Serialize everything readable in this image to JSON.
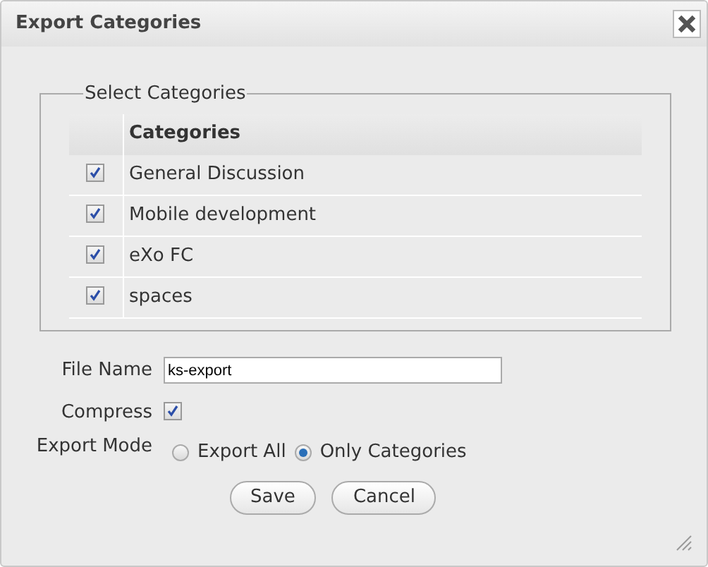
{
  "window": {
    "title": "Export Categories"
  },
  "fieldset": {
    "legend": "Select Categories",
    "column": "Categories",
    "rows": [
      {
        "name": "General Discussion",
        "checked": true
      },
      {
        "name": "Mobile development",
        "checked": true
      },
      {
        "name": "eXo FC",
        "checked": true
      },
      {
        "name": "spaces",
        "checked": true
      }
    ]
  },
  "file_name": {
    "label": "File Name",
    "value": "ks-export"
  },
  "compress": {
    "label": "Compress",
    "checked": true
  },
  "export_mode": {
    "label": "Export Mode",
    "options": [
      {
        "label": "Export All",
        "selected": false
      },
      {
        "label": "Only Categories",
        "selected": true
      }
    ]
  },
  "buttons": [
    "Save",
    "Cancel"
  ]
}
